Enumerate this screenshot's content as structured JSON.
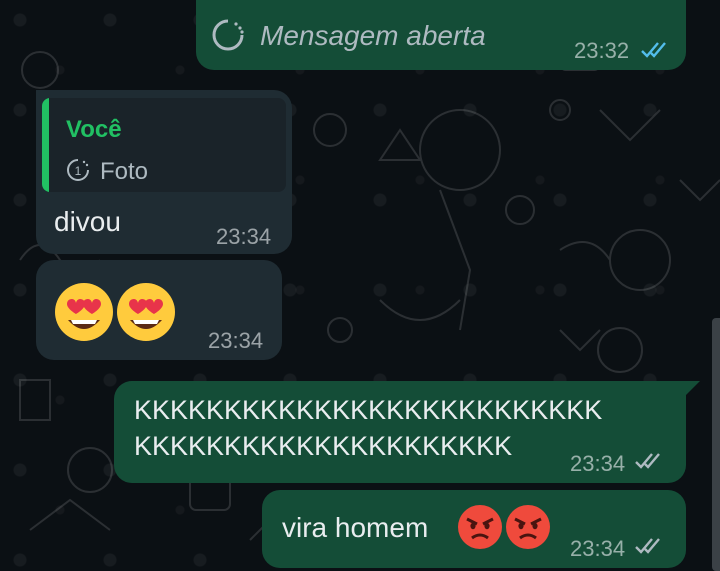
{
  "messages": [
    {
      "id": "m1",
      "direction": "outgoing",
      "type": "view_once_opened",
      "text": "Mensagem aberta",
      "time": "23:32",
      "status": "read"
    },
    {
      "id": "m2",
      "direction": "incoming",
      "type": "reply",
      "quote_author": "Você",
      "quote_text": "Foto",
      "text": "divou",
      "time": "23:34"
    },
    {
      "id": "m3",
      "direction": "incoming",
      "type": "emoji",
      "emojis": [
        "heart-eyes-emoji",
        "heart-eyes-emoji"
      ],
      "time": "23:34"
    },
    {
      "id": "m4",
      "direction": "outgoing",
      "type": "text",
      "line1": "KKKKKKKKKKKKKKKKKKKKKKKKKK",
      "line2": "KKKKKKKKKKKKKKKKKKKKK",
      "time": "23:34",
      "status": "delivered"
    },
    {
      "id": "m5",
      "direction": "outgoing",
      "type": "text_emoji",
      "text": "vira homem",
      "emojis": [
        "angry-face-emoji",
        "angry-face-emoji"
      ],
      "time": "23:34",
      "status": "delivered"
    }
  ],
  "colors": {
    "outgoing_bubble": "#144d37",
    "incoming_bubble": "#1f2c33",
    "quote_accent": "#21c063",
    "read_tick": "#53bdeb",
    "sent_tick": "#8696a0",
    "background": "#0b1014"
  }
}
